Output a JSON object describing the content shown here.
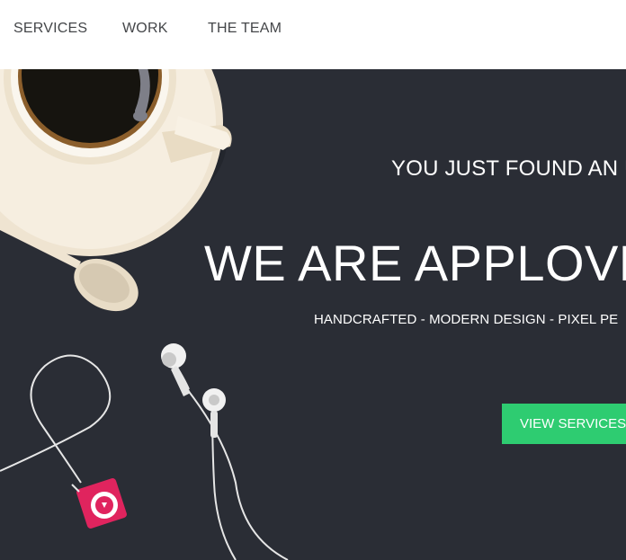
{
  "nav": {
    "items": [
      {
        "label": "SERVICES"
      },
      {
        "label": "WORK"
      },
      {
        "label": "THE TEAM"
      }
    ]
  },
  "hero": {
    "tagline": "YOU JUST FOUND AN U",
    "headline": "WE ARE APPLOVE",
    "subtitle": "HANDCRAFTED - MODERN DESIGN - PIXEL PE",
    "cta_label": "VIEW SERVICES"
  },
  "colors": {
    "hero_background": "#2a2d35",
    "accent": "#2ecc71",
    "nav_text": "#444649",
    "player": "#e0245e"
  }
}
